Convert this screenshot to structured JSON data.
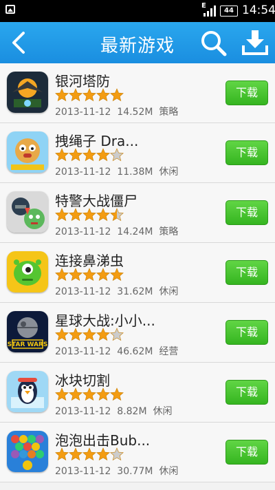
{
  "status_bar": {
    "time": "14:54",
    "battery": "44",
    "network": "E"
  },
  "header": {
    "title": "最新游戏"
  },
  "colors": {
    "header": "#1a8ee0",
    "star": "#f39c12",
    "star_empty": "#cccccc",
    "download": "#35b520"
  },
  "apps": [
    {
      "name": "银河塔防",
      "date": "2013-11-12",
      "size": "14.52M",
      "category": "策略",
      "rating": 5,
      "button": "下载"
    },
    {
      "name": "拽绳子 Dra...",
      "date": "2013-11-12",
      "size": "11.38M",
      "category": "休闲",
      "rating": 4,
      "button": "下载"
    },
    {
      "name": "特警大战僵尸",
      "date": "2013-11-12",
      "size": "14.24M",
      "category": "策略",
      "rating": 4.5,
      "button": "下载"
    },
    {
      "name": "连接鼻涕虫",
      "date": "2013-11-12",
      "size": "31.62M",
      "category": "休闲",
      "rating": 5,
      "button": "下载"
    },
    {
      "name": "星球大战:小小...",
      "date": "2013-11-12",
      "size": "46.62M",
      "category": "经营",
      "rating": 4,
      "button": "下载"
    },
    {
      "name": "冰块切割",
      "date": "2013-11-12",
      "size": "8.82M",
      "category": "休闲",
      "rating": 5,
      "button": "下载"
    },
    {
      "name": "泡泡出击Bub...",
      "date": "2013-11-12",
      "size": "30.77M",
      "category": "休闲",
      "rating": 4,
      "button": "下载"
    }
  ]
}
